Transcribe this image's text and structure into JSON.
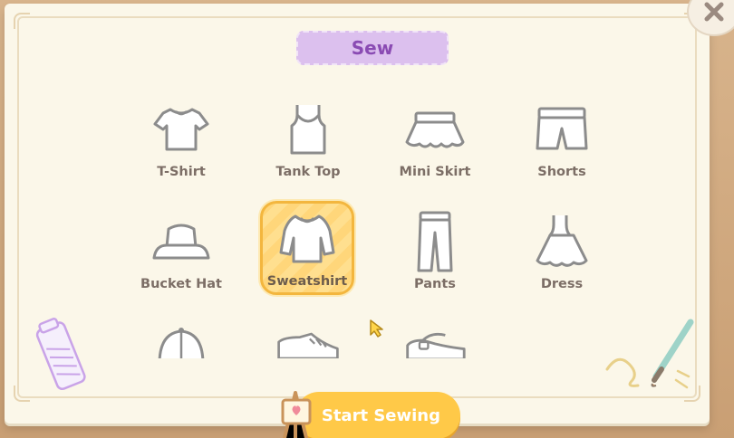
{
  "panel": {
    "title": "Sew"
  },
  "items": [
    {
      "label": "T-Shirt",
      "icon": "tshirt-icon",
      "selected": false
    },
    {
      "label": "Tank Top",
      "icon": "tank-top-icon",
      "selected": false
    },
    {
      "label": "Mini Skirt",
      "icon": "mini-skirt-icon",
      "selected": false
    },
    {
      "label": "Shorts",
      "icon": "shorts-icon",
      "selected": false
    },
    {
      "label": "Bucket Hat",
      "icon": "bucket-hat-icon",
      "selected": false
    },
    {
      "label": "Sweatshirt",
      "icon": "sweatshirt-icon",
      "selected": true
    },
    {
      "label": "Pants",
      "icon": "pants-icon",
      "selected": false
    },
    {
      "label": "Dress",
      "icon": "dress-icon",
      "selected": false
    }
  ],
  "partial_items": [
    {
      "icon": "cap-icon"
    },
    {
      "icon": "sneaker-icon"
    },
    {
      "icon": "mary-jane-shoe-icon"
    }
  ],
  "actions": {
    "start_label": "Start Sewing"
  },
  "colors": {
    "accent": "#ffc948",
    "title_bg": "#dcc0ee",
    "title_text": "#8a4bb3",
    "selected_border": "#f3b63e"
  }
}
